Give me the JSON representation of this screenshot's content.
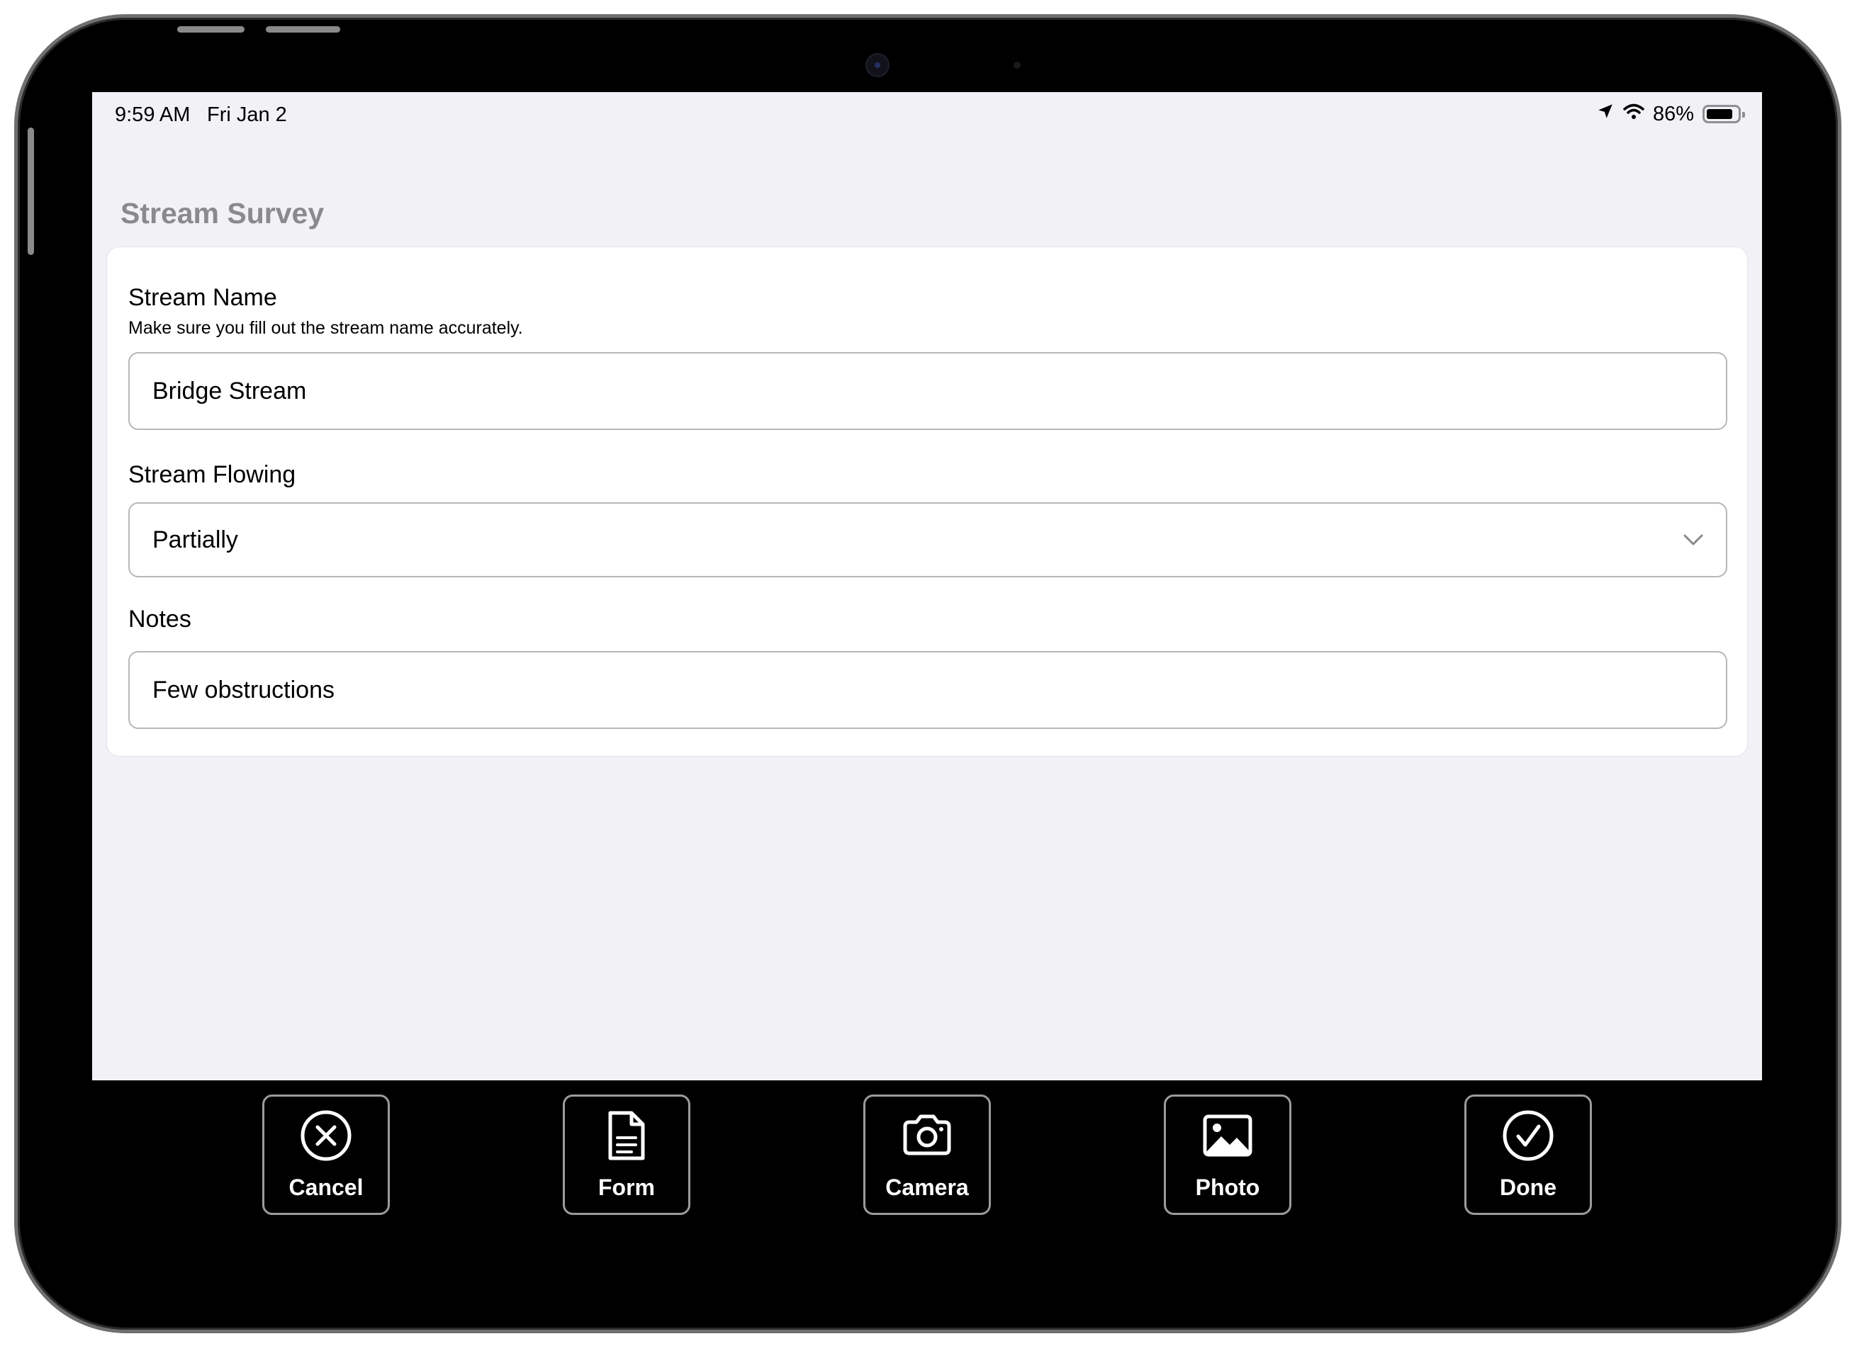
{
  "status_bar": {
    "time": "9:59 AM",
    "date": "Fri Jan 2",
    "battery_text": "86%",
    "battery_level": 0.86,
    "icons": [
      "location-arrow-icon",
      "wifi-icon",
      "battery-icon"
    ]
  },
  "page": {
    "title": "Stream Survey"
  },
  "form": {
    "stream_name": {
      "label": "Stream Name",
      "help": "Make sure you fill out the stream name accurately.",
      "value": "Bridge Stream"
    },
    "stream_flowing": {
      "label": "Stream Flowing",
      "value": "Partially"
    },
    "notes": {
      "label": "Notes",
      "value": "Few obstructions"
    }
  },
  "toolbar": {
    "cancel": {
      "label": "Cancel",
      "icon": "x-circle-icon"
    },
    "form": {
      "label": "Form",
      "icon": "document-icon"
    },
    "camera": {
      "label": "Camera",
      "icon": "camera-icon"
    },
    "photo": {
      "label": "Photo",
      "icon": "photo-icon"
    },
    "done": {
      "label": "Done",
      "icon": "checkmark-circle-icon"
    }
  }
}
